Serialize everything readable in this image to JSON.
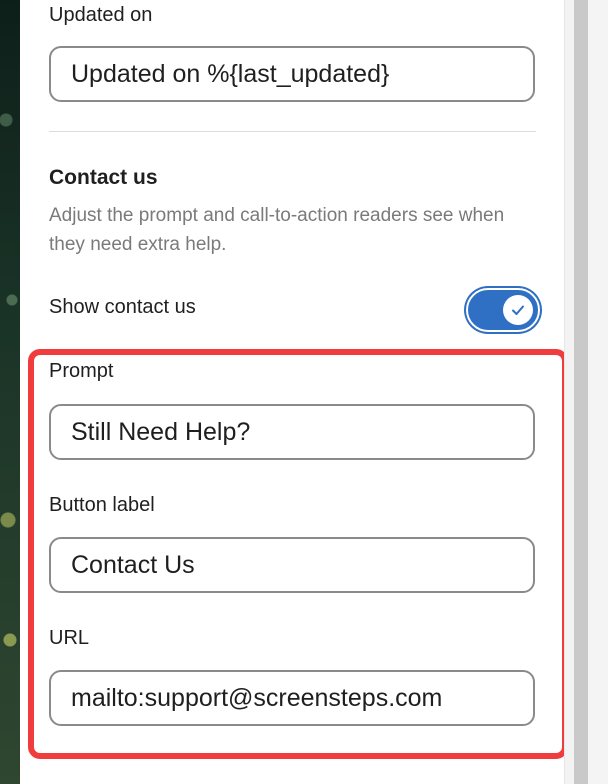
{
  "updated_on": {
    "label": "Updated on",
    "value": "Updated on %{last_updated}"
  },
  "contact_us": {
    "title": "Contact us",
    "description": "Adjust the prompt and call-to-action readers see when they need extra help.",
    "toggle_label": "Show contact us",
    "toggle_on": true,
    "prompt_label": "Prompt",
    "prompt_value": "Still Need Help?",
    "button_label_label": "Button label",
    "button_label_value": "Contact Us",
    "url_label": "URL",
    "url_value": "mailto:support@screensteps.com"
  },
  "colors": {
    "toggle_on": "#2f6fc4",
    "highlight": "#f03c3c"
  }
}
